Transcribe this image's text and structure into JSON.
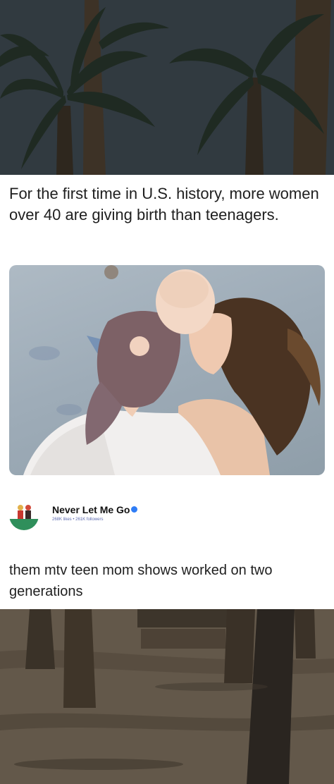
{
  "post": {
    "headline": "For the first time in U.S. history, more women over 40 are giving birth than teenagers.",
    "caption": "them mtv teen mom shows worked on two generations"
  },
  "author": {
    "name": "Never Let Me Go",
    "meta": "268K likes • 261K followers",
    "verified_color": "#2f7df6"
  },
  "icons": {
    "avatar": "couple-avatar-icon",
    "verified": "verified-badge-icon"
  },
  "colors": {
    "card_background": "#ffffff",
    "text": "#1f1f1f"
  }
}
